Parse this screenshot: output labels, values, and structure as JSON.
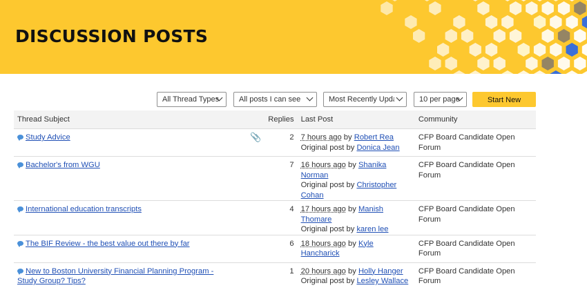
{
  "banner": {
    "title": "DISCUSSION POSTS"
  },
  "colors": {
    "brand_yellow": "#fdc82f",
    "link_blue": "#1f4fb5",
    "hex_blue": "#3a6fd8",
    "hex_gray": "#8a7d6a"
  },
  "filters": {
    "thread_types": "All Thread Types",
    "posts_scope": "All posts I can see",
    "sort": "Most Recently Updated",
    "per_page": "10 per page"
  },
  "buttons": {
    "new_thread": "Start New Thread"
  },
  "table": {
    "headers": {
      "subject": "Thread Subject",
      "replies": "Replies",
      "last_post": "Last Post",
      "community": "Community"
    },
    "labels": {
      "by": "by",
      "original_post_by": "Original post by"
    },
    "rows": [
      {
        "icon": "chat-bubble-icon",
        "subject": "Study Advice",
        "has_attachment": true,
        "replies": "2",
        "last_ago": "7 hours ago",
        "last_author": "Robert Rea",
        "original_author": "Donica Jean",
        "community": "CFP Board Candidate Open Forum"
      },
      {
        "icon": "chat-bubble-icon",
        "subject": "Bachelor's from WGU",
        "has_attachment": false,
        "replies": "7",
        "last_ago": "16 hours ago",
        "last_author": "Shanika Norman",
        "original_author": "Christopher Cohan",
        "community": "CFP Board Candidate Open Forum"
      },
      {
        "icon": "chat-bubble-icon",
        "subject": "International education transcripts",
        "has_attachment": false,
        "replies": "4",
        "last_ago": "17 hours ago",
        "last_author": "Manish Thomare",
        "original_author": "karen lee",
        "community": "CFP Board Candidate Open Forum"
      },
      {
        "icon": "chat-bubble-icon",
        "subject": "The BIF Review - the best value out there by far",
        "has_attachment": false,
        "replies": "6",
        "last_ago": "18 hours ago",
        "last_author": "Kyle Hancharick",
        "original_author": "",
        "community": "CFP Board Candidate Open Forum"
      },
      {
        "icon": "chat-bubble-icon",
        "subject": "New to Boston University Financial Planning Program - Study Group? Tips?",
        "has_attachment": false,
        "replies": "1",
        "last_ago": "20 hours ago",
        "last_author": "Holly Hanger",
        "original_author": "Lesley Wallace",
        "community": "CFP Board Candidate Open Forum"
      }
    ]
  }
}
